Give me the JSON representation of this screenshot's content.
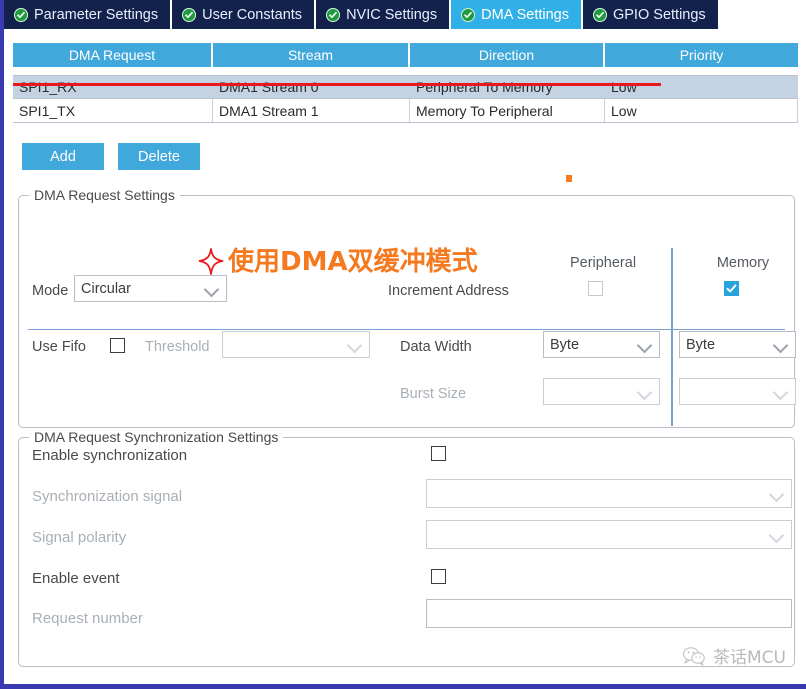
{
  "tabs": [
    {
      "label": "Parameter Settings",
      "icon": "check-circle-icon",
      "active": false
    },
    {
      "label": "User Constants",
      "icon": "check-circle-icon",
      "active": false
    },
    {
      "label": "NVIC Settings",
      "icon": "check-circle-icon",
      "active": false
    },
    {
      "label": "DMA Settings",
      "icon": "check-circle-icon",
      "active": true
    },
    {
      "label": "GPIO Settings",
      "icon": "check-circle-icon",
      "active": false
    }
  ],
  "table": {
    "headers": [
      "DMA Request",
      "Stream",
      "Direction",
      "Priority"
    ],
    "rows": [
      {
        "request": "SPI1_RX",
        "stream": "DMA1 Stream 0",
        "direction": "Peripheral To Memory",
        "priority": "Low",
        "selected": true
      },
      {
        "request": "SPI1_TX",
        "stream": "DMA1 Stream 1",
        "direction": "Memory To Peripheral",
        "priority": "Low",
        "selected": false
      }
    ]
  },
  "buttons": {
    "add": "Add",
    "delete": "Delete"
  },
  "annotation": {
    "text": "使用DMA双缓冲模式",
    "color": "#f4791f",
    "marker": "four-point-star-icon",
    "marker_color": "#e8181c"
  },
  "request_settings": {
    "title": "DMA Request Settings",
    "column_headers": {
      "peripheral": "Peripheral",
      "memory": "Memory"
    },
    "mode": {
      "label": "Mode",
      "value": "Circular"
    },
    "increment_address": {
      "label": "Increment Address",
      "peripheral_checked": false,
      "memory_checked": true
    },
    "use_fifo": {
      "label": "Use Fifo",
      "checked": false
    },
    "threshold": {
      "label": "Threshold",
      "value": "",
      "disabled": true
    },
    "data_width": {
      "label": "Data Width",
      "peripheral_value": "Byte",
      "memory_value": "Byte"
    },
    "burst_size": {
      "label": "Burst Size",
      "peripheral_value": "",
      "memory_value": "",
      "disabled": true
    }
  },
  "sync_settings": {
    "title": "DMA Request Synchronization Settings",
    "enable_synchronization": {
      "label": "Enable synchronization",
      "checked": false
    },
    "synchronization_signal": {
      "label": "Synchronization signal",
      "value": "",
      "disabled": true
    },
    "signal_polarity": {
      "label": "Signal polarity",
      "value": "",
      "disabled": true
    },
    "enable_event": {
      "label": "Enable event",
      "checked": false
    },
    "request_number": {
      "label": "Request number",
      "value": "",
      "disabled": true
    }
  },
  "watermark": {
    "text": "茶话MCU",
    "icon": "wechat-bubble-icon"
  },
  "colors": {
    "tab_bar": "#13224c",
    "tab_active": "#31b0e8",
    "table_header": "#41a8dc",
    "row_selected": "#c3d3e4",
    "annotation_orange": "#f4791f",
    "underline_red": "#e8181c",
    "frame_border": "#3a3ab0"
  }
}
